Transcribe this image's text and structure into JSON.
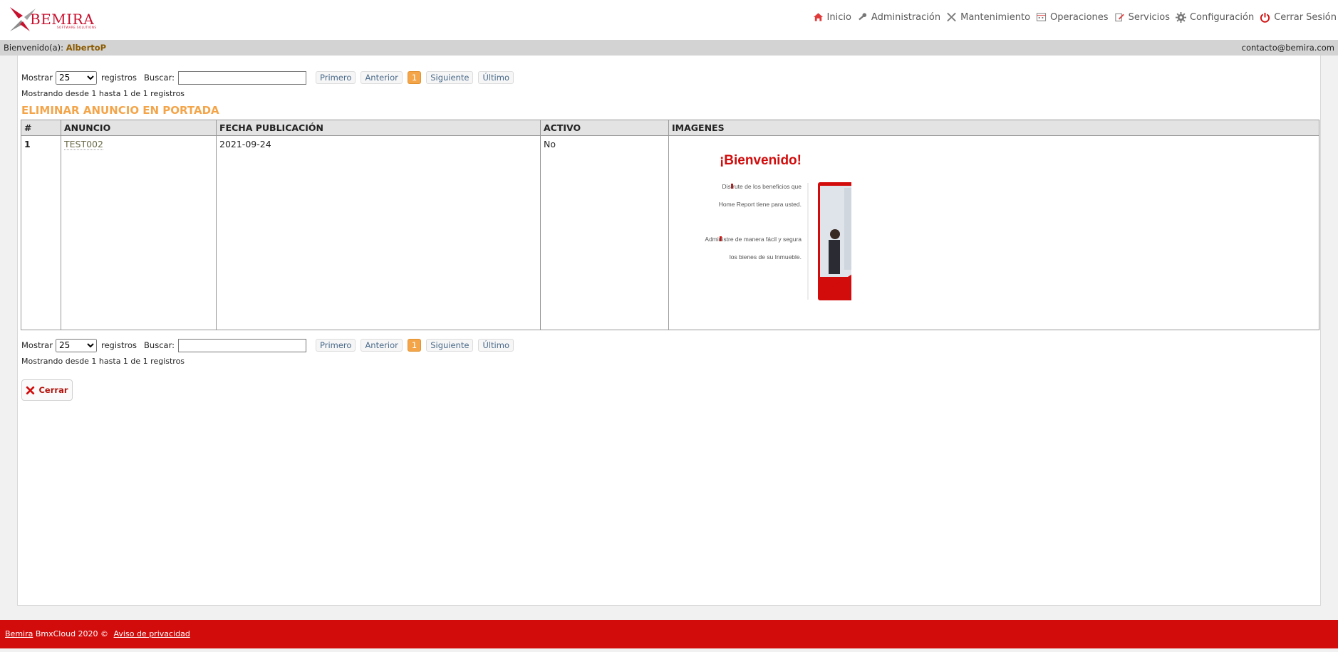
{
  "header": {
    "logo_text": "BEMIRA",
    "logo_tagline": "SOFTWARE SOLUTIONS",
    "nav": [
      {
        "label": "Inicio",
        "icon": "home-icon"
      },
      {
        "label": "Administración",
        "icon": "key-icon"
      },
      {
        "label": "Mantenimiento",
        "icon": "tools-icon"
      },
      {
        "label": "Operaciones",
        "icon": "calendar-icon"
      },
      {
        "label": "Servicios",
        "icon": "edit-icon"
      },
      {
        "label": "Configuración",
        "icon": "gear-icon"
      },
      {
        "label": "Cerrar Sesión",
        "icon": "power-icon"
      }
    ]
  },
  "welcome": {
    "prefix": "Bienvenido(a):",
    "user": "AlbertoP",
    "email": "contacto@bemira.com"
  },
  "controls": {
    "show_label": "Mostrar",
    "show_value": "25",
    "records_label": "registros",
    "search_label": "Buscar:",
    "search_value": "",
    "first": "Primero",
    "prev": "Anterior",
    "current_page": "1",
    "next": "Siguiente",
    "last": "Último",
    "info": "Mostrando desde 1 hasta 1 de 1 registros"
  },
  "page_title": "ELIMINAR ANUNCIO EN PORTADA",
  "table": {
    "headers": [
      "#",
      "ANUNCIO",
      "FECHA PUBLICACIÓN",
      "ACTIVO",
      "IMAGENES"
    ],
    "rows": [
      {
        "num": "1",
        "anuncio": "TEST002",
        "fecha": "2021-09-24",
        "activo": "No"
      }
    ]
  },
  "promo_image": {
    "heading": "¡Bienvenido!",
    "line1": "Disfrute de los beneficios que",
    "line2": "Home Report tiene para usted.",
    "line3": "Administre de manera fácil y segura",
    "line4": "los bienes de su Inmueble."
  },
  "close_button": "Cerrar",
  "footer": {
    "brand": "Bemira",
    "text": "BmxCloud 2020 ©",
    "privacy": "Aviso de privacidad"
  },
  "colors": {
    "accent_orange": "#f4a54a",
    "brand_red": "#d20b0b",
    "user_brown": "#8b5a00"
  }
}
